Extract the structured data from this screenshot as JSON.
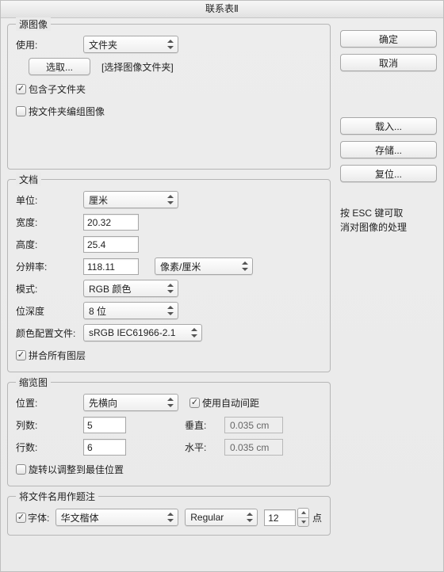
{
  "window_title": "联系表Ⅱ",
  "source": {
    "legend": "源图像",
    "use_label": "使用:",
    "use_value": "文件夹",
    "browse_button": "选取...",
    "browse_hint": "[选择图像文件夹]",
    "include_subfolders_label": "包含子文件夹",
    "include_subfolders_checked": true,
    "group_by_folder_label": "按文件夹编组图像",
    "group_by_folder_checked": false
  },
  "doc": {
    "legend": "文档",
    "unit_label": "单位:",
    "unit_value": "厘米",
    "width_label": "宽度:",
    "width_value": "20.32",
    "height_label": "高度:",
    "height_value": "25.4",
    "res_label": "分辨率:",
    "res_value": "118.11",
    "res_unit_value": "像素/厘米",
    "mode_label": "模式:",
    "mode_value": "RGB 颜色",
    "bitdepth_label": "位深度",
    "bitdepth_value": "8 位",
    "profile_label": "颜色配置文件:",
    "profile_value": "sRGB IEC61966-2.1",
    "flatten_label": "拼合所有图层",
    "flatten_checked": true
  },
  "thumbs": {
    "legend": "缩览图",
    "place_label": "位置:",
    "place_value": "先横向",
    "auto_spacing_label": "使用自动间距",
    "auto_spacing_checked": true,
    "cols_label": "列数:",
    "cols_value": "5",
    "vert_label": "垂直:",
    "vert_value": "0.035 cm",
    "rows_label": "行数:",
    "rows_value": "6",
    "horz_label": "水平:",
    "horz_value": "0.035 cm",
    "rotate_label": "旋转以调整到最佳位置",
    "rotate_checked": false
  },
  "caption": {
    "legend": "将文件名用作题注",
    "enable_checked": true,
    "font_label": "字体:",
    "font_value": "华文楷体",
    "style_value": "Regular",
    "size_value": "12",
    "pt_label": "点"
  },
  "buttons": {
    "ok": "确定",
    "cancel": "取消",
    "load": "载入...",
    "store": "存储...",
    "reset": "复位..."
  },
  "hint_line1": "按 ESC 键可取",
  "hint_line2": "消对图像的处理"
}
